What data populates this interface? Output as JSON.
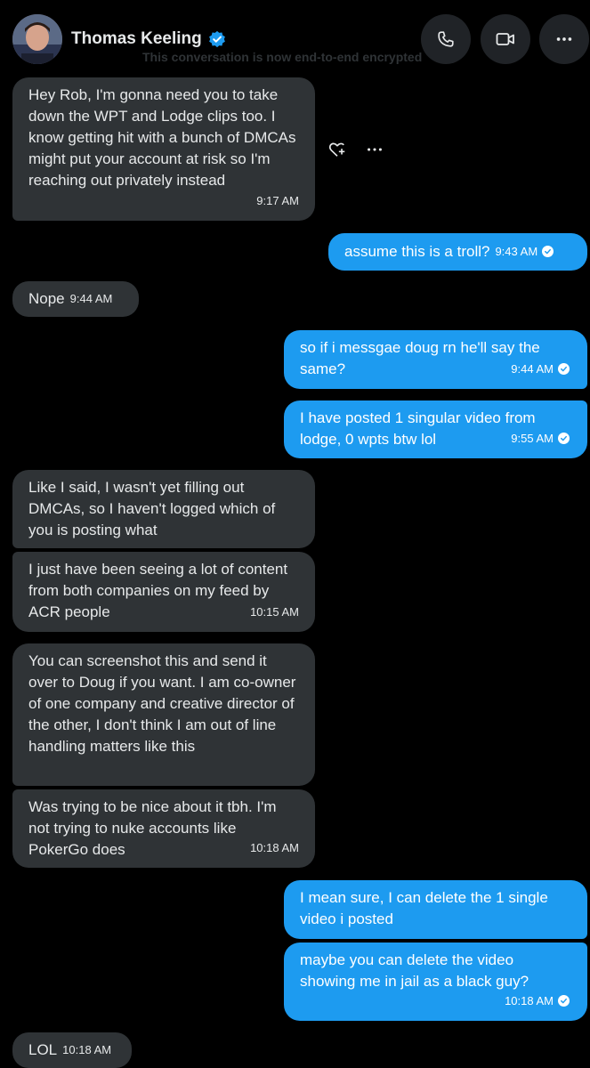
{
  "header": {
    "contact_name": "Thomas Keeling",
    "encryption_notice": "This conversation is now end-to-end encrypted"
  },
  "messages": [
    {
      "direction": "in",
      "text": "Hey Rob, I'm gonna need you to take down the WPT and Lodge clips too. I know getting hit with a bunch of DMCAs might put your account at risk so I'm reaching out privately instead",
      "time": "9:17 AM"
    },
    {
      "direction": "out",
      "text": "assume this is a troll?",
      "time": "9:43 AM"
    },
    {
      "direction": "in",
      "text": "Nope",
      "time": "9:44 AM"
    },
    {
      "direction": "out",
      "text": "so if i messgae doug rn he'll say the same?",
      "time": "9:44 AM"
    },
    {
      "direction": "out",
      "text": "I have posted 1 singular video from lodge, 0 wpts btw lol",
      "time": "9:55 AM"
    },
    {
      "direction": "in",
      "text": "Like I said, I wasn't yet filling out DMCAs, so I haven't logged which of you is posting what",
      "time": ""
    },
    {
      "direction": "in",
      "text": "I just have been seeing a lot of content from both companies on my feed by ACR people",
      "time": "10:15 AM"
    },
    {
      "direction": "in",
      "text": "You can screenshot this and send it over to Doug if you want. I am co-owner of one company and creative director of the other, I don't think I am out of line handling matters like this",
      "time": ""
    },
    {
      "direction": "in",
      "text": "Was trying to be nice about it tbh. I'm not trying to nuke accounts like PokerGo does",
      "time": "10:18 AM"
    },
    {
      "direction": "out",
      "text": "I mean sure, I can delete the 1 single video i posted",
      "time": ""
    },
    {
      "direction": "out",
      "text": "maybe you can delete the video showing me in jail as a black guy?",
      "time": "10:18 AM"
    },
    {
      "direction": "in",
      "text": "LOL",
      "time": "10:18 AM"
    }
  ],
  "colors": {
    "background": "#000000",
    "incoming_bubble": "#2f3336",
    "outgoing_bubble": "#1d9bf0",
    "verified_badge": "#1d9bf0"
  },
  "icons": [
    "avatar",
    "verified-badge-icon",
    "phone-icon",
    "video-icon",
    "more-icon",
    "add-reaction-icon",
    "message-more-icon",
    "read-receipt-icon"
  ]
}
